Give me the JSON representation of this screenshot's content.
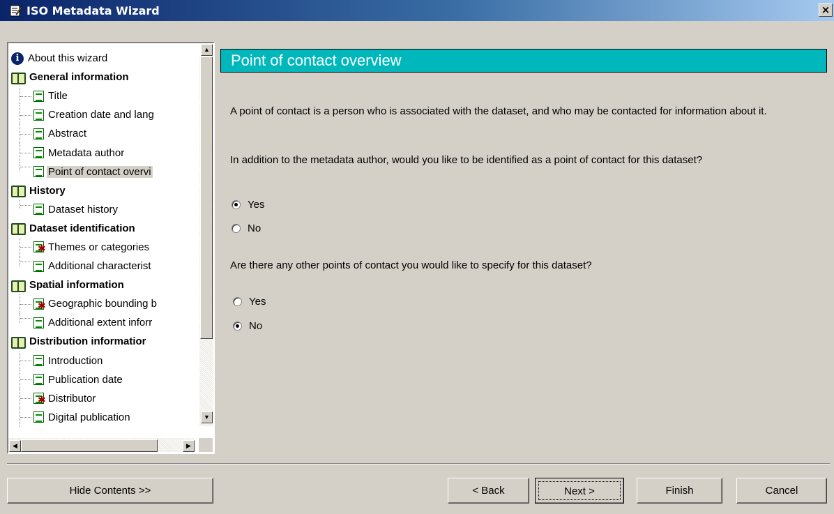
{
  "window": {
    "title": "ISO Metadata Wizard",
    "close_label": "×"
  },
  "tree": {
    "items": [
      {
        "type": "about",
        "label": "About this wizard",
        "icon": "info-icon"
      },
      {
        "type": "section",
        "label": "General information",
        "icon": "book-icon"
      },
      {
        "type": "leaf",
        "label": "Title",
        "icon": "page-icon"
      },
      {
        "type": "leaf",
        "label": "Creation date and lang",
        "icon": "page-icon"
      },
      {
        "type": "leaf",
        "label": "Abstract",
        "icon": "page-icon"
      },
      {
        "type": "leaf",
        "label": "Metadata author",
        "icon": "page-icon"
      },
      {
        "type": "leaf",
        "label": "Point of contact overvi",
        "icon": "page-icon",
        "selected": true,
        "last": true
      },
      {
        "type": "section",
        "label": "History",
        "icon": "book-icon"
      },
      {
        "type": "leaf",
        "label": "Dataset history",
        "icon": "page-icon",
        "last": true
      },
      {
        "type": "section",
        "label": "Dataset identification",
        "icon": "book-icon"
      },
      {
        "type": "leaf",
        "label": "Themes or categories",
        "icon": "page-required-icon",
        "required": true
      },
      {
        "type": "leaf",
        "label": "Additional characterist",
        "icon": "page-icon",
        "last": true
      },
      {
        "type": "section",
        "label": "Spatial information",
        "icon": "book-icon"
      },
      {
        "type": "leaf",
        "label": "Geographic bounding b",
        "icon": "page-required-icon",
        "required": true
      },
      {
        "type": "leaf",
        "label": "Additional extent inforr",
        "icon": "page-icon",
        "last": true
      },
      {
        "type": "section",
        "label": "Distribution informatior",
        "icon": "book-icon"
      },
      {
        "type": "leaf",
        "label": "Introduction",
        "icon": "page-icon"
      },
      {
        "type": "leaf",
        "label": "Publication date",
        "icon": "page-icon"
      },
      {
        "type": "leaf",
        "label": "Distributor",
        "icon": "page-required-icon",
        "required": true
      },
      {
        "type": "leaf",
        "label": "Digital publication",
        "icon": "page-icon"
      }
    ]
  },
  "main": {
    "heading": "Point of contact overview",
    "intro": "A point of contact is a person who is associated with the dataset, and who may be contacted for information about it.",
    "question1": "In addition to the metadata author, would you like to be identified as a point of contact for this dataset?",
    "q1_options": {
      "yes": "Yes",
      "no": "No",
      "selected": "Yes"
    },
    "question2": "Are there any other points of contact you would like to specify for this dataset?",
    "q2_options": {
      "yes": "Yes",
      "no": "No",
      "selected": "No"
    }
  },
  "buttons": {
    "hide_contents": "Hide Contents >>",
    "back": "< Back",
    "next": "Next >",
    "finish": "Finish",
    "cancel": "Cancel"
  },
  "colors": {
    "header_bg": "#00b8bc",
    "titlebar_start": "#0a246a",
    "titlebar_end": "#a6caf0"
  }
}
